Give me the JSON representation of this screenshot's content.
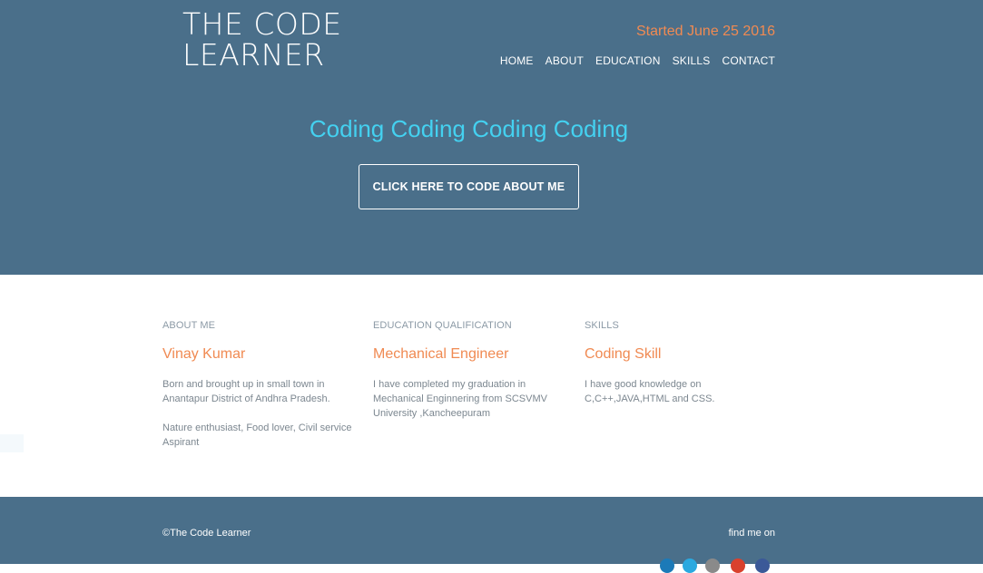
{
  "header": {
    "logo_line1": "THE CODE",
    "logo_line2": "LEARNER",
    "started": "Started June 25 2016",
    "nav": [
      "HOME",
      "ABOUT",
      "EDUCATION",
      "SKILLS",
      "CONTACT"
    ],
    "hero_title": "Coding Coding Coding Coding",
    "cta_label": "CLICK HERE TO CODE ABOUT ME"
  },
  "sections": {
    "about": {
      "heading": "ABOUT ME",
      "title": "Vinay Kumar",
      "text1": "Born and brought up in small town in Anantapur District of Andhra Pradesh.",
      "text2": "Nature enthusiast, Food lover, Civil service Aspirant"
    },
    "education": {
      "heading": "EDUCATION QUALIFICATION",
      "title": "Mechanical Engineer",
      "text1": "I have completed my graduation in Mechanical Enginnering from SCSVMV University ,Kancheepuram"
    },
    "skills": {
      "heading": "SKILLS",
      "title": "Coding Skill",
      "text1": "I have good knowledge on C,C++,JAVA,HTML and CSS."
    }
  },
  "footer": {
    "copyright": "©The Code Learner",
    "find_me": "find me on"
  },
  "colors": {
    "header_bg": "#4a6f8a",
    "accent_orange": "#f08a52",
    "accent_cyan": "#44d1f0"
  },
  "social_icons": [
    "linkedin-icon",
    "twitter-icon",
    "github-icon",
    "google-plus-icon",
    "facebook-icon"
  ]
}
